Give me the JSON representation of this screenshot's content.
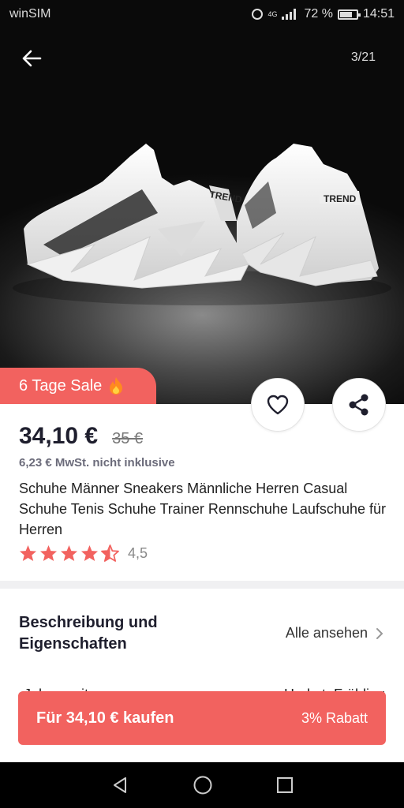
{
  "status_bar": {
    "carrier": "winSIM",
    "network": "4G",
    "battery": "72 %",
    "time": "14:51"
  },
  "gallery": {
    "counter": "3/21",
    "shoe_brand_text": "TREND"
  },
  "sale_badge": "6 Tage Sale",
  "product": {
    "price": "34,10 €",
    "old_price": "35 €",
    "vat_note": "6,23 € MwSt. nicht inklusive",
    "title": "Schuhe Männer Sneakers Männliche Herren Casual Schuhe Tenis Schuhe Trainer Rennschuhe Laufschuhe für Herren",
    "rating": 4.5,
    "rating_text": "4,5"
  },
  "description": {
    "heading": "Beschreibung und Eigenschaften",
    "see_all": "Alle ansehen",
    "peek_left": "Jahreszeit",
    "peek_right": "Herbst, Frühling"
  },
  "buy_bar": {
    "label": "Für 34,10 € kaufen",
    "discount": "3% Rabatt"
  },
  "colors": {
    "accent": "#f2625f",
    "star": "#f2625f"
  }
}
